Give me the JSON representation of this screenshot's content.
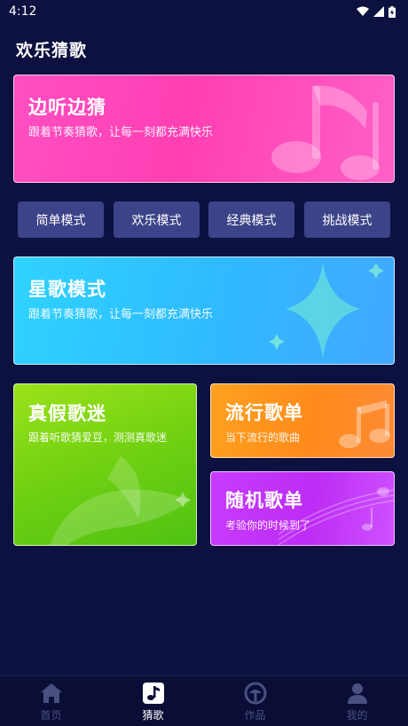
{
  "status": {
    "time": "4:12"
  },
  "page": {
    "title": "欢乐猜歌"
  },
  "hero1": {
    "title": "边听边猜",
    "subtitle": "跟着节奏猜歌，让每一刻都充满快乐"
  },
  "modes": [
    {
      "label": "简单模式"
    },
    {
      "label": "欢乐模式"
    },
    {
      "label": "经典模式"
    },
    {
      "label": "挑战模式"
    }
  ],
  "hero2": {
    "title": "星歌模式",
    "subtitle": "跟着节奏猜歌，让每一刻都充满快乐"
  },
  "card_green": {
    "title": "真假歌迷",
    "subtitle": "跟着听歌猜爱豆，测测真歌迷"
  },
  "card_orange": {
    "title": "流行歌单",
    "subtitle": "当下流行的歌曲"
  },
  "card_purple": {
    "title": "随机歌单",
    "subtitle": "考验你的时候到了"
  },
  "tabs": [
    {
      "label": "首页",
      "icon": "home-icon"
    },
    {
      "label": "猜歌",
      "icon": "music-note-icon",
      "active": true
    },
    {
      "label": "作品",
      "icon": "works-icon"
    },
    {
      "label": "我的",
      "icon": "profile-icon"
    }
  ],
  "colors": {
    "background": "#0d1140",
    "hero1": "#ff3fb2",
    "hero2": "#2fbbff",
    "mode_button": "#3c4388",
    "green_card": "#6fd011",
    "orange_card": "#ff8a1b",
    "purple_card": "#bd2cf4",
    "tab_inactive": "#4a5080",
    "tab_active": "#ffffff"
  }
}
